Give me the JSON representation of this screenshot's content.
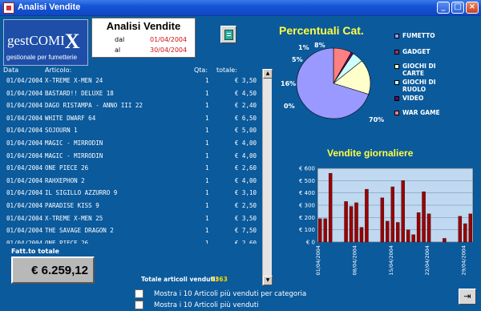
{
  "window": {
    "title": "Analisi Vendite"
  },
  "logo": {
    "brand_a": "gest",
    "brand_b": "COMI",
    "brand_c": "X",
    "tagline": "gestionale per fumetterie"
  },
  "header": {
    "title": "Analisi Vendite",
    "from_label": "dal",
    "from_date": "01/04/2004",
    "to_label": "al",
    "to_date": "30/04/2004"
  },
  "columns": {
    "date": "Data",
    "article": "Articolo:",
    "qty": "Qta:",
    "total": "totale:"
  },
  "rows": [
    {
      "date": "01/04/2004",
      "article": "X-TREME X-MEN 24",
      "qty": "1",
      "total": "€ 3,50"
    },
    {
      "date": "01/04/2004",
      "article": "BASTARD!! DELUXE 18",
      "qty": "1",
      "total": "€ 4,50"
    },
    {
      "date": "01/04/2004",
      "article": "DAGO RISTAMPA - ANNO III 22",
      "qty": "1",
      "total": "€ 2,40"
    },
    {
      "date": "01/04/2004",
      "article": "WHITE DWARF 64",
      "qty": "1",
      "total": "€ 6,50"
    },
    {
      "date": "01/04/2004",
      "article": "SOJOURN 1",
      "qty": "1",
      "total": "€ 5,00"
    },
    {
      "date": "01/04/2004",
      "article": "MAGIC - MIRRODIN",
      "qty": "1",
      "total": "€ 4,00"
    },
    {
      "date": "01/04/2004",
      "article": "MAGIC - MIRRODIN",
      "qty": "1",
      "total": "€ 4,00"
    },
    {
      "date": "01/04/2004",
      "article": "ONE PIECE 26",
      "qty": "1",
      "total": "€ 2,60"
    },
    {
      "date": "01/04/2004",
      "article": "RAHXEPHON 2",
      "qty": "1",
      "total": "€ 4,00"
    },
    {
      "date": "01/04/2004",
      "article": "IL SIGILLO AZZURRO 9",
      "qty": "1",
      "total": "€ 3,10"
    },
    {
      "date": "01/04/2004",
      "article": "PARADISE KISS 9",
      "qty": "1",
      "total": "€ 2,50"
    },
    {
      "date": "01/04/2004",
      "article": "X-TREME X-MEN 25",
      "qty": "1",
      "total": "€ 3,50"
    },
    {
      "date": "01/04/2004",
      "article": "THE SAVAGE DRAGON 2",
      "qty": "1",
      "total": "€ 7,50"
    },
    {
      "date": "01/04/2004",
      "article": "ONE PIECE 26",
      "qty": "1",
      "total": "€ 2,60"
    }
  ],
  "totals": {
    "fatt_label": "Fatt.to totale",
    "fatt_value": "€ 6.259,12",
    "articles_label": "Totale articoli venduti:",
    "articles_value": "1363"
  },
  "options": [
    {
      "label": "Mostra i 10 Articoli più venduti per categoria"
    },
    {
      "label": "Mostra i 10 Articoli più venduti"
    }
  ],
  "icons": {
    "notes": "notebook-icon",
    "exit": "exit-door-icon"
  },
  "chart_data": [
    {
      "type": "pie",
      "title": "Percentuali Cat.",
      "categories": [
        "FUMETTO",
        "GADGET",
        "GIOCHI DI CARTE",
        "GIOCHI DI RUOLO",
        "VIDEO",
        "WAR GAME"
      ],
      "values": [
        70,
        0,
        16,
        5,
        1,
        8
      ],
      "labels": [
        "70%",
        "0%",
        "16%",
        "5%",
        "1%",
        "8%"
      ],
      "colors": [
        "#9999ff",
        "#993366",
        "#ffffcc",
        "#ccffff",
        "#660066",
        "#ff8080"
      ],
      "legend": "right"
    },
    {
      "type": "bar",
      "title": "Vendite giornaliere",
      "yticks": [
        "€ 0",
        "€ 100",
        "€ 200",
        "€ 300",
        "€ 400",
        "€ 500",
        "€ 600"
      ],
      "ylim": [
        0,
        600
      ],
      "xticks": [
        "01/04/2004",
        "08/04/2004",
        "15/04/2004",
        "22/04/2004",
        "29/04/2004"
      ],
      "values": [
        190,
        190,
        560,
        0,
        0,
        330,
        290,
        320,
        120,
        430,
        0,
        0,
        360,
        170,
        450,
        160,
        500,
        100,
        60,
        240,
        410,
        230,
        0,
        0,
        30,
        0,
        0,
        210,
        150,
        230
      ],
      "bar_color": "#990000",
      "grid": true
    }
  ]
}
